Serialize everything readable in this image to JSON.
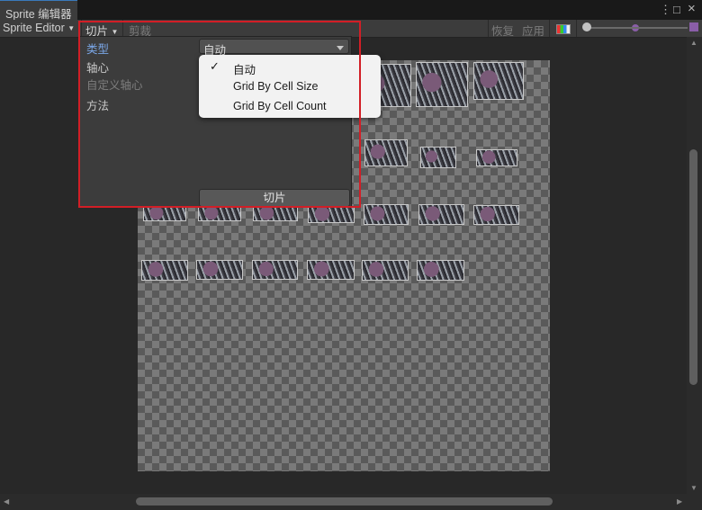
{
  "window": {
    "tab_title": "Sprite 编辑器",
    "more_icon": "⋮",
    "maximize_icon": "□",
    "close_icon": "×"
  },
  "toolbar": {
    "editor_mode": "Sprite Editor",
    "slice_menu": "切片",
    "trim": "剪裁",
    "revert": "恢复",
    "apply": "应用"
  },
  "slice_panel": {
    "type_label": "类型",
    "type_value": "自动",
    "pivot_label": "轴心",
    "custom_pivot_label": "自定义轴心",
    "method_label": "方法",
    "slice_button": "切片"
  },
  "dropdown_menu": {
    "items": [
      {
        "label": "自动",
        "checked": true
      },
      {
        "label": "Grid By Cell Size",
        "checked": false
      },
      {
        "label": "Grid By Cell Count",
        "checked": false
      }
    ],
    "check_glyph": "✓"
  },
  "colors": {
    "highlight_border": "#d21e26",
    "selected_label": "#7aa6e6"
  }
}
